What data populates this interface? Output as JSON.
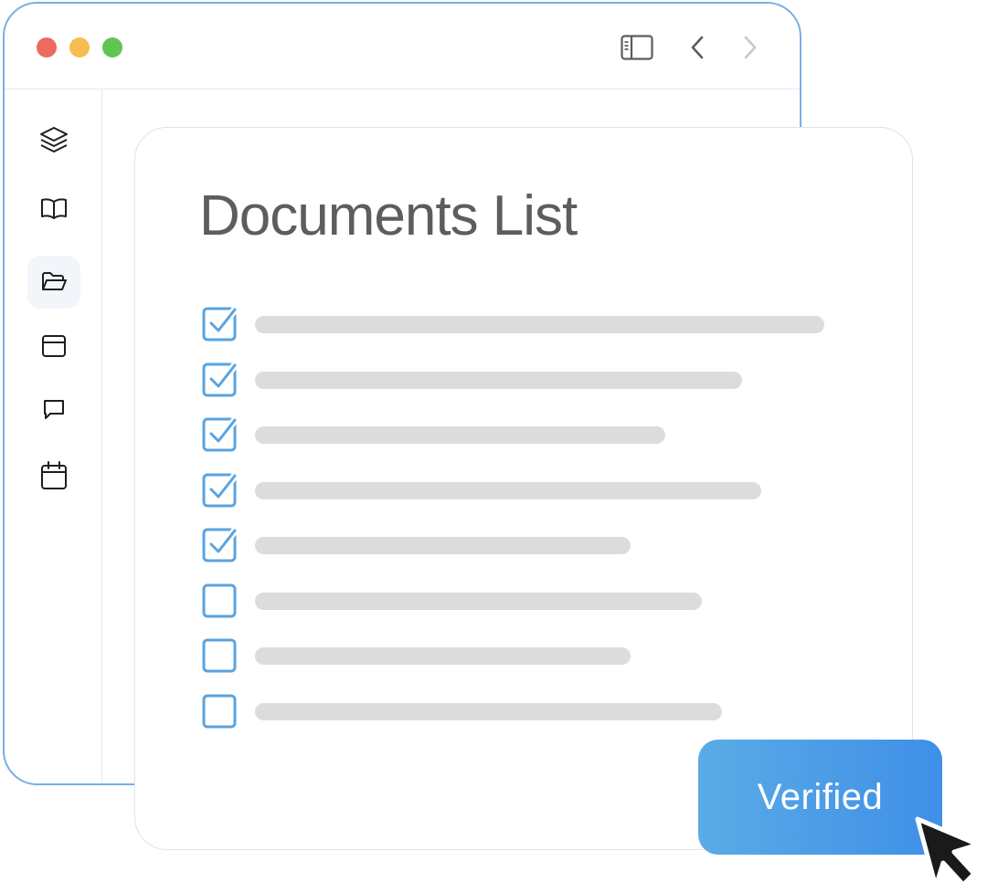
{
  "colors": {
    "window_border": "#7aaee8",
    "dot_red": "#ec6a5e",
    "dot_yellow": "#f4bf4f",
    "dot_green": "#61c554",
    "checkbox": "#5aa3df",
    "placeholder_bar": "#dcdcdc",
    "title_text": "#5d5d5d",
    "button_start": "#5aabe6",
    "button_end": "#3f8fe8"
  },
  "titlebar": {
    "icons": [
      "sidebar-toggle-icon",
      "chevron-left-icon",
      "chevron-right-icon"
    ]
  },
  "sidebar": {
    "items": [
      {
        "icon": "layers-icon",
        "active": false
      },
      {
        "icon": "book-icon",
        "active": false
      },
      {
        "icon": "folder-open-icon",
        "active": true
      },
      {
        "icon": "window-icon",
        "active": false
      },
      {
        "icon": "chat-icon",
        "active": false
      },
      {
        "icon": "calendar-icon",
        "active": false
      }
    ]
  },
  "document": {
    "title": "Documents List",
    "rows": [
      {
        "checked": true,
        "bar_length": 1.0
      },
      {
        "checked": true,
        "bar_length": 0.855
      },
      {
        "checked": true,
        "bar_length": 0.72
      },
      {
        "checked": true,
        "bar_length": 0.89
      },
      {
        "checked": true,
        "bar_length": 0.66
      },
      {
        "checked": false,
        "bar_length": 0.785
      },
      {
        "checked": false,
        "bar_length": 0.66
      },
      {
        "checked": false,
        "bar_length": 0.82
      }
    ]
  },
  "action": {
    "label": "Verified"
  }
}
